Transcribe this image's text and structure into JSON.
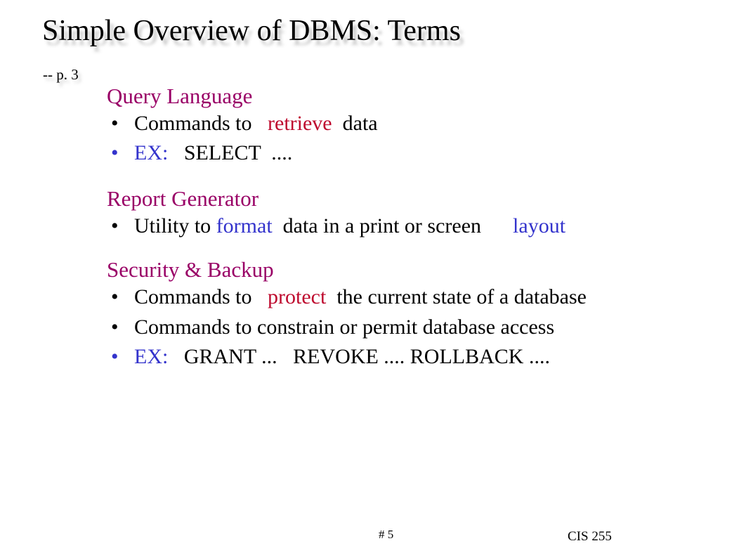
{
  "slide": {
    "title": "Simple Overview of DBMS: Terms",
    "subtitle": "-- p. 3",
    "colors": {
      "heading_purple": "#990066",
      "emphasis_red": "#BE0A2E",
      "emphasis_blue": "#3333CC",
      "body_black": "#000000",
      "background": "#FFFFFF"
    },
    "groups": [
      {
        "heading": "Query Language",
        "bullets": [
          {
            "bullet_color": "#000000",
            "runs": [
              {
                "text": "Commands to ",
                "color": "#000000"
              },
              {
                "text": "  retrieve",
                "color": "#BE0A2E"
              },
              {
                "text": "  data",
                "color": "#000000"
              }
            ]
          },
          {
            "bullet_color": "#3333CC",
            "runs": [
              {
                "text": "EX:",
                "color": "#3333CC"
              },
              {
                "text": "   SELECT  ....",
                "color": "#000000"
              }
            ]
          }
        ]
      },
      {
        "heading": "Report Generator",
        "bullets": [
          {
            "bullet_color": "#000000",
            "runs": [
              {
                "text": "Utility to ",
                "color": "#000000"
              },
              {
                "text": "format",
                "color": "#3333CC"
              },
              {
                "text": "  data in a print or screen",
                "color": "#000000"
              },
              {
                "text": "      layout",
                "color": "#3333CC"
              }
            ]
          }
        ]
      },
      {
        "heading": "Security & Backup",
        "bullets": [
          {
            "bullet_color": "#000000",
            "runs": [
              {
                "text": "Commands to ",
                "color": "#000000"
              },
              {
                "text": "  protect",
                "color": "#BE0A2E"
              },
              {
                "text": "  the current state of a database",
                "color": "#000000"
              }
            ]
          },
          {
            "bullet_color": "#000000",
            "runs": [
              {
                "text": "Commands to constrain or permit database access",
                "color": "#000000"
              }
            ]
          },
          {
            "bullet_color": "#3333CC",
            "runs": [
              {
                "text": "EX:",
                "color": "#3333CC"
              },
              {
                "text": "   GRANT ...   REVOKE .... ROLLBACK ....",
                "color": "#000000"
              }
            ]
          }
        ]
      }
    ],
    "footer": {
      "slide_number": "# 5",
      "course": "CIS 255"
    },
    "bullet_glyph": "•"
  }
}
